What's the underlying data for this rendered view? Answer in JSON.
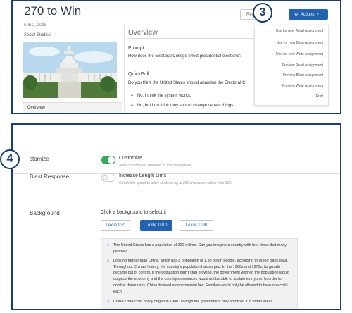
{
  "top": {
    "title": "270 to Win",
    "date": "Feb 2, 2018",
    "subject": "Social Studies",
    "sidebar_item": "Overview",
    "overview_heading": "Overview",
    "prompt_label": "Prompt:",
    "prompt_text": "How does the Electoral College effect presidential elections?",
    "quickpoll_label": "QuickPoll:",
    "quickpoll_text": "Do you think the United States should abandon the Electoral C",
    "poll_options": [
      "No, I think the system works.",
      "No, but I do think they should change certain things."
    ],
    "return_label": "Return",
    "actions_label": "Actions",
    "dropdown_items": [
      "Use for new Read Assignment",
      "Use for new Blast Assignment",
      "Use for new Write Assignment",
      "Preview Read Assignment",
      "Preview Blast Assignment",
      "Preview Write Assignment",
      "Print"
    ],
    "badge": "3"
  },
  "bottom": {
    "badge": "4",
    "customize_label": "stomize",
    "customize_title": "Customize",
    "customize_desc": "Allow customized attributes to this assignment.",
    "customize_on": true,
    "blast_label": "Blast Response",
    "blast_title": "Increase Length Limit",
    "blast_desc": "Check this option to allow students up to 280 characters rather than 160.",
    "blast_on": false,
    "background_label": "Background",
    "background_instruction": "Click a background to select it",
    "lexile_options": [
      "Lexile 930",
      "Lexile 1010",
      "Lexile 1190"
    ],
    "lexile_selected": "Lexile 1010",
    "paragraphs": [
      {
        "num": "1",
        "text": "The United States has a population of 320 million. Can you imagine a country with four times that many people?"
      },
      {
        "num": "2",
        "text": "Look no further than China, which has a population of 1.38 billion people, according to World Bank data. Throughout China's history, the country's population has surged. In the 1960s and 1970s, its growth became out of control. If the population didn't stop growing, the government worried the population would outpace the economy and the country's resources would not be able to sustain everyone. In order to combat these risks, China devised a controversial law. Families would only be allowed to have one child each."
      },
      {
        "num": "3",
        "text": "China's one-child policy began in 1980. Though the government only enforced it in urban areas"
      }
    ]
  },
  "colors": {
    "frame": "#1a3f6f",
    "primary": "#2163b0",
    "toggle_on": "#3aa55c"
  }
}
